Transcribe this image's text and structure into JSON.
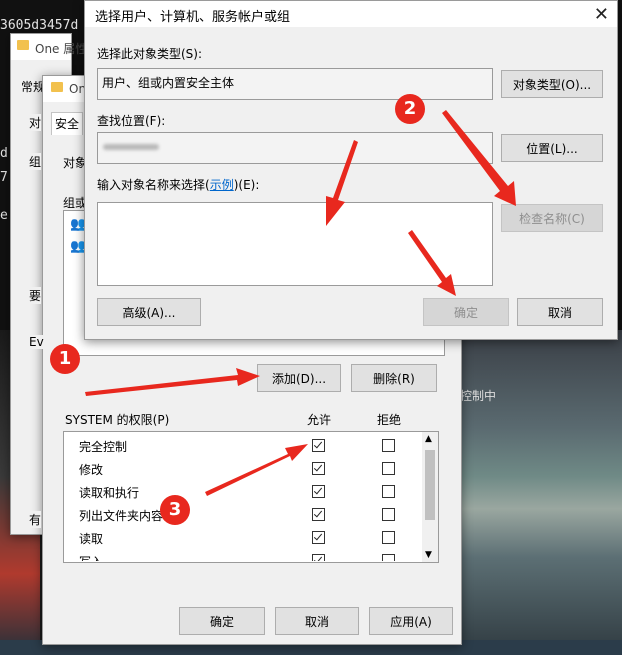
{
  "background": {
    "left_texts": [
      "3605d3457d",
      "d",
      "7",
      "e"
    ],
    "right_text": "控制中"
  },
  "win_back": {
    "title": "One 属性",
    "tab_general": "常规"
  },
  "properties": {
    "title": "One",
    "tab_security": "安全",
    "left_letters": [
      "对",
      "组",
      "要",
      "Ev",
      "有"
    ],
    "object_label": "对象",
    "group_label": "组或",
    "add_button": "添加(D)...",
    "remove_button": "删除(R)",
    "perm_header": "SYSTEM 的权限(P)",
    "allow_header": "允许",
    "deny_header": "拒绝",
    "permissions": [
      {
        "name": "完全控制",
        "allow": true,
        "deny": false
      },
      {
        "name": "修改",
        "allow": true,
        "deny": false
      },
      {
        "name": "读取和执行",
        "allow": true,
        "deny": false
      },
      {
        "name": "列出文件夹内容",
        "allow": true,
        "deny": false
      },
      {
        "name": "读取",
        "allow": true,
        "deny": false
      },
      {
        "name": "写入",
        "allow": true,
        "deny": false
      }
    ],
    "ok_button": "确定",
    "cancel_button": "取消",
    "apply_button": "应用(A)"
  },
  "select_dialog": {
    "title": "选择用户、计算机、服务帐户或组",
    "object_type_label": "选择此对象类型(S):",
    "object_type_value": "用户、组或内置安全主体",
    "object_type_button": "对象类型(O)...",
    "location_label": "查找位置(F):",
    "location_value": "",
    "location_button": "位置(L)...",
    "input_label_prefix": "输入对象名称来选择(",
    "input_label_link": "示例",
    "input_label_suffix": ")(E):",
    "input_value": "",
    "check_names_button": "检查名称(C)",
    "advanced_button": "高级(A)...",
    "ok_button": "确定",
    "cancel_button": "取消"
  },
  "annotations": {
    "badge1": "1",
    "badge2": "2",
    "badge3": "3",
    "color": "#e8281e"
  }
}
